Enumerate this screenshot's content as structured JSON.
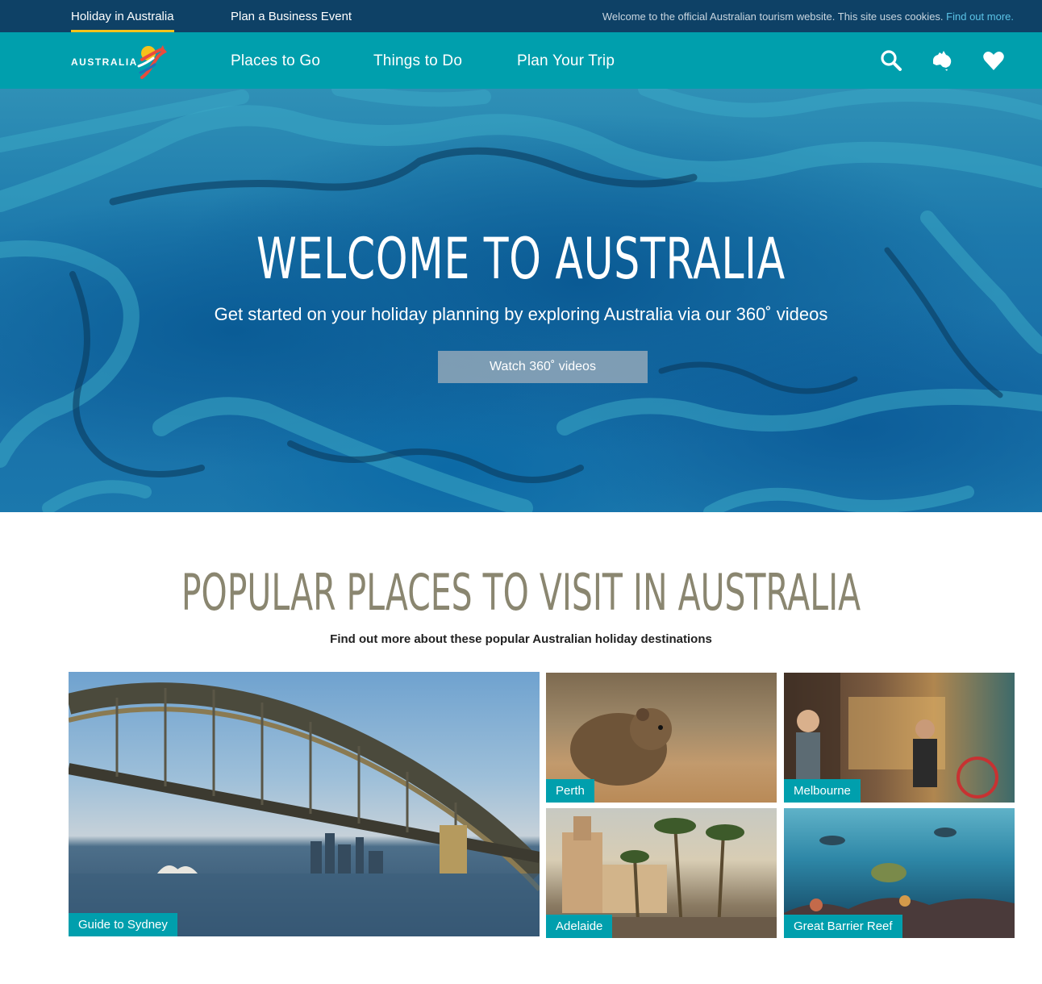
{
  "topbar": {
    "tab_holiday": "Holiday in Australia",
    "tab_business": "Plan a Business Event",
    "cookie_text": "Welcome to the official Australian tourism website. This site uses cookies.",
    "cookie_link": "Find out more."
  },
  "nav": {
    "logo_text": "AUSTRALIA",
    "items": [
      {
        "label": "Places to Go"
      },
      {
        "label": "Things to Do"
      },
      {
        "label": "Plan Your Trip"
      }
    ],
    "icons": [
      "search-icon",
      "australia-map-icon",
      "heart-icon"
    ]
  },
  "hero": {
    "title": "WELCOME TO AUSTRALIA",
    "subtitle": "Get started on your holiday planning by exploring Australia via our 360˚ videos",
    "button": "Watch 360˚ videos"
  },
  "popular": {
    "title": "POPULAR PLACES TO VISIT IN AUSTRALIA",
    "subtitle": "Find out more about these popular Australian holiday destinations",
    "tiles": [
      {
        "label": "Guide to Sydney"
      },
      {
        "label": "Perth"
      },
      {
        "label": "Melbourne"
      },
      {
        "label": "Adelaide"
      },
      {
        "label": "Great Barrier Reef"
      }
    ]
  },
  "colors": {
    "topbar": "#0e4166",
    "nav": "#009fad",
    "active_underline": "#f5c21b",
    "section_title": "#8a8670",
    "tile_label": "#009fad"
  }
}
